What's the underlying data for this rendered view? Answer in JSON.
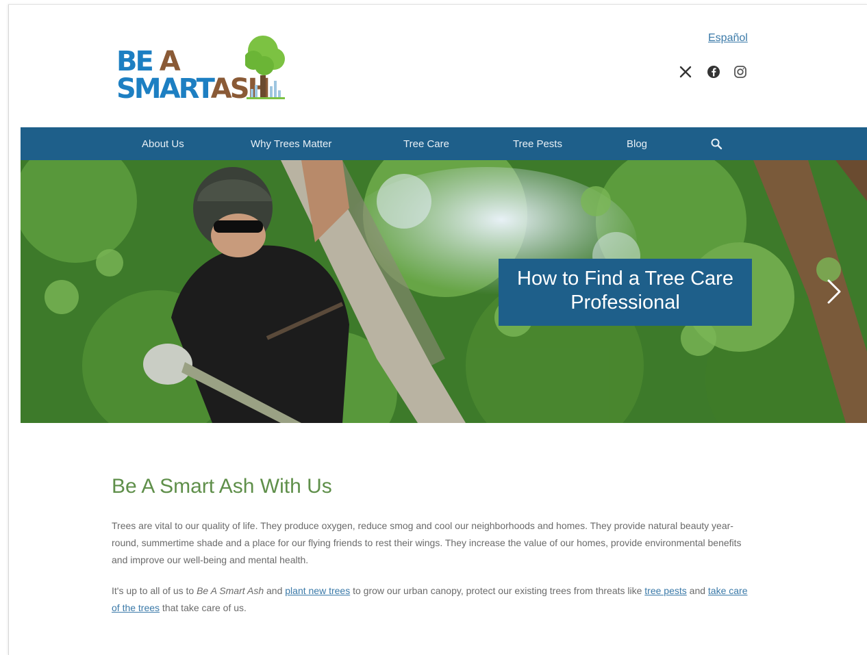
{
  "logo": {
    "line1_a": "BE",
    "line1_b": "A",
    "line2_a": "SMART",
    "line2_b": "ASH"
  },
  "header": {
    "language_link": "Español",
    "social": [
      "x-icon",
      "facebook-icon",
      "instagram-icon"
    ]
  },
  "nav": {
    "items": [
      "About Us",
      "Why Trees Matter",
      "Tree Care",
      "Tree Pests",
      "Blog"
    ],
    "search_icon": "search-icon"
  },
  "hero": {
    "caption": "How to Find a Tree Care Professional",
    "next_icon": "chevron-right-icon"
  },
  "content": {
    "title": "Be A Smart Ash With Us",
    "para1": "Trees are vital to our quality of life. They produce oxygen, reduce smog and cool our neighborhoods and homes. They provide natural beauty year-round, summertime shade and a place for our flying friends to rest their wings. They increase the value of our homes, provide environmental benefits and improve our well-being and mental health.",
    "para2": {
      "t1": "It's up to all of us to ",
      "em": "Be A Smart Ash",
      "t2": " and ",
      "link1": "plant new trees",
      "t3": " to grow our urban canopy, protect our existing trees from threats like ",
      "link2": "tree pests",
      "t4": " and ",
      "link3": "take care of the trees",
      "t5": " that take care of us."
    }
  },
  "colors": {
    "nav_blue": "#1e5f8a",
    "logo_blue": "#1d7fc2",
    "logo_brown": "#8a5a36",
    "title_green": "#5f8f4a",
    "link_blue": "#3a79a8"
  }
}
